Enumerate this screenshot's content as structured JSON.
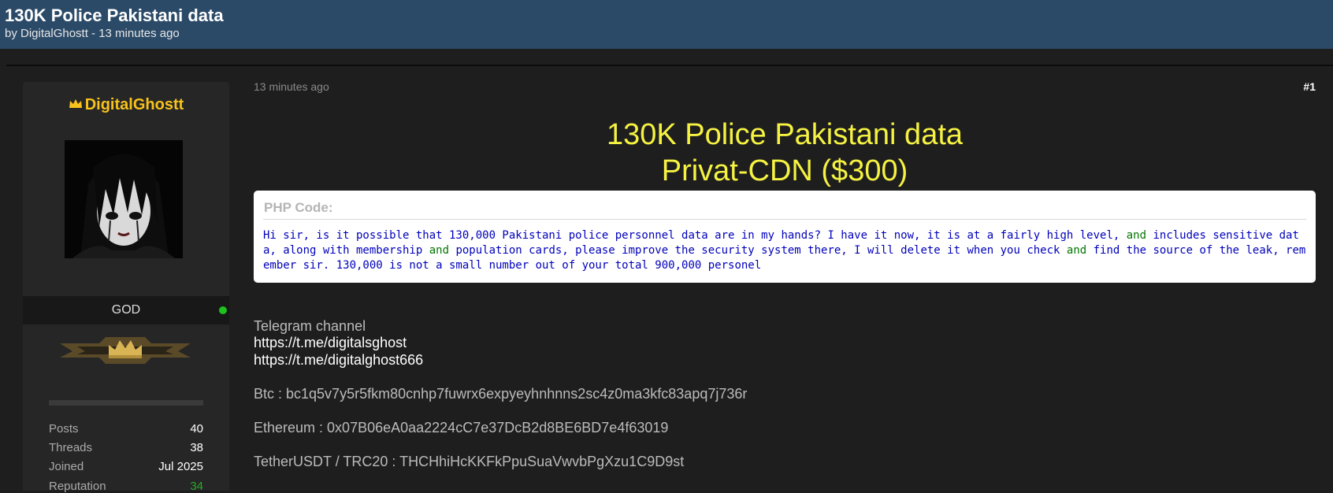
{
  "header": {
    "title": "130K Police Pakistani data",
    "meta": "by DigitalGhostt - 13 minutes ago"
  },
  "user": {
    "name": "DigitalGhostt",
    "rank": "GOD",
    "name_color": "#f7c21b",
    "online_color": "#1ec21e",
    "stats": [
      {
        "label": "Posts",
        "value": "40"
      },
      {
        "label": "Threads",
        "value": "38"
      },
      {
        "label": "Joined",
        "value": "Jul 2025"
      },
      {
        "label": "Reputation",
        "value": "34"
      }
    ]
  },
  "post": {
    "time": "13 minutes ago",
    "number": "#1",
    "title_line1": "130K Police Pakistani data",
    "title_line2": "Privat-CDN ($300)",
    "code": {
      "label": "PHP Code:",
      "segments": [
        "Hi sir, is it possible that 130,000 Pakistani police personnel data are in my hands? I have it now, it is at a fairly high level, ",
        "and",
        " includes sensitive data, along with membership ",
        "and",
        " population cards, please improve the security system there, I will delete it when you check ",
        "and",
        " find the source of the leak, remember sir. 130,000 is not a small number out of your total 900,000 personel"
      ]
    },
    "telegram_label": "Telegram channel",
    "telegram_links": [
      "https://t.me/digitalsghost",
      "https://t.me/digitalghost666"
    ],
    "btc": "Btc : bc1q5v7y5r5fkm80cnhp7fuwrx6expyeyhnhnns2sc4z0ma3kfc83apq7j736r",
    "eth": "Ethereum : 0x07B06eA0aa2224cC7e37DcB2d8BE6BD7e4f63019",
    "usdt": "TetherUSDT / TRC20 : THCHhiHcKKFkPpuSuaVwvbPgXzu1C9D9st"
  },
  "colors": {
    "header_bg": "#2b4a68",
    "title_yellow": "#f5f242",
    "code_blue": "#0000bb",
    "code_green": "#007700"
  }
}
